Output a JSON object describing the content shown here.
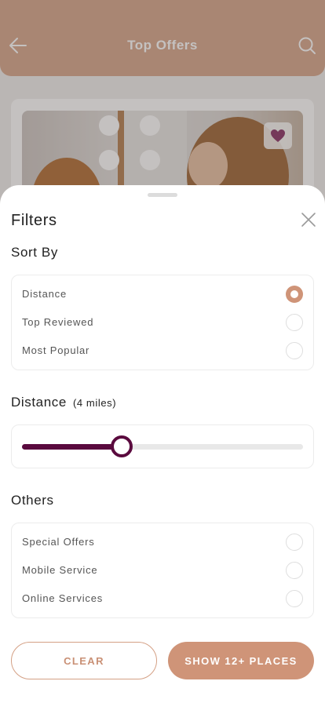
{
  "header": {
    "title": "Top Offers",
    "back_icon": "arrow-left-icon",
    "search_icon": "search-icon"
  },
  "offer_card": {
    "favorite_icon": "heart-icon",
    "favorite_color": "#8e3b6e"
  },
  "filters": {
    "title": "Filters",
    "close_icon": "close-icon",
    "sort_by": {
      "title": "Sort By",
      "options": [
        {
          "label": "Distance",
          "selected": true
        },
        {
          "label": "Top Reviewed",
          "selected": false
        },
        {
          "label": "Most Popular",
          "selected": false
        }
      ]
    },
    "distance": {
      "title": "Distance",
      "value_label": "(4 miles)",
      "level": 0.355
    },
    "others": {
      "title": "Others",
      "options": [
        {
          "label": "Special Offers",
          "selected": false
        },
        {
          "label": "Mobile Service",
          "selected": false
        },
        {
          "label": "Online Services",
          "selected": false
        }
      ]
    },
    "buttons": {
      "clear": "CLEAR",
      "show": "SHOW 12+ PLACES"
    }
  },
  "colors": {
    "accent": "#cf9478",
    "slider": "#5a0a3e",
    "header": "#d8ab91"
  }
}
